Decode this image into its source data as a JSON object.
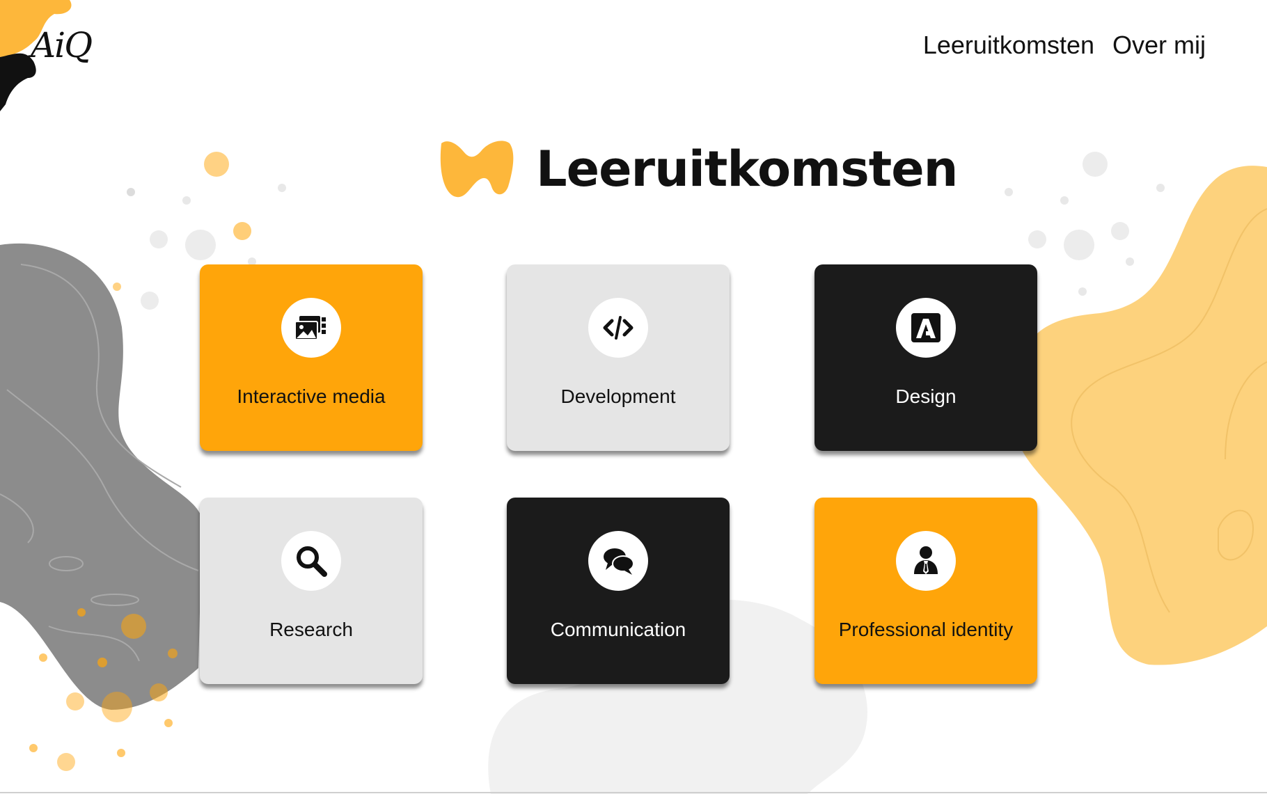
{
  "brand": {
    "logo_text": "AiQ",
    "logo_icon": "paint-splash-icon",
    "colors": {
      "orange": "#ffa50a",
      "light_orange": "#fdd27d",
      "gray": "#8c8c8c",
      "card_gray": "#e5e5e5",
      "card_black": "#1b1b1b"
    }
  },
  "nav": {
    "items": [
      {
        "label": "Leeruitkomsten"
      },
      {
        "label": "Over mij"
      }
    ]
  },
  "page": {
    "title": "Leeruitkomsten",
    "title_icon": "orange-brush-mark-icon"
  },
  "cards": [
    {
      "label": "Interactive media",
      "icon": "media-gallery-icon",
      "theme": "orange"
    },
    {
      "label": "Development",
      "icon": "code-icon",
      "theme": "gray"
    },
    {
      "label": "Design",
      "icon": "adobe-icon",
      "theme": "black"
    },
    {
      "label": "Research",
      "icon": "search-icon",
      "theme": "gray"
    },
    {
      "label": "Communication",
      "icon": "chat-bubbles-icon",
      "theme": "black"
    },
    {
      "label": "Professional identity",
      "icon": "person-tie-icon",
      "theme": "orange"
    }
  ]
}
